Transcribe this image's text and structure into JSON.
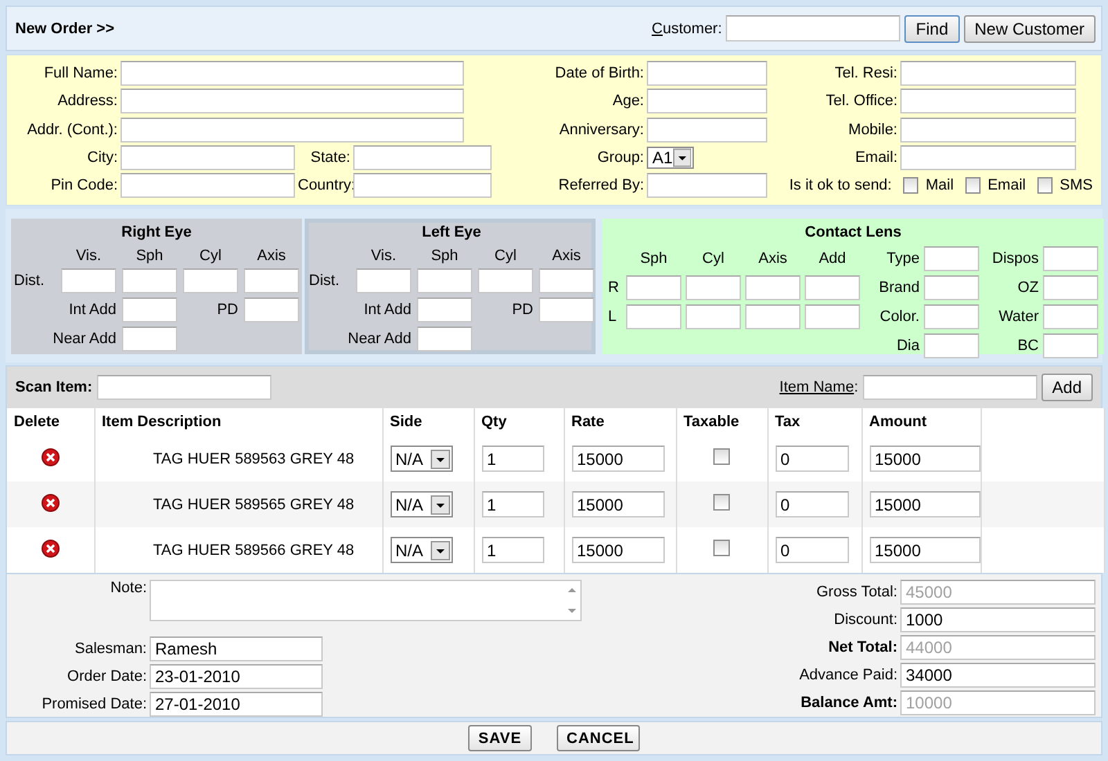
{
  "header": {
    "title": "New Order >>",
    "customer": {
      "label": "Customer",
      "suffix": ":"
    },
    "buttons": [
      "Find",
      "New Customer"
    ]
  },
  "customer": {
    "col1": [
      {
        "fields": [
          {
            "label": "Full Name:"
          }
        ]
      },
      {
        "fields": [
          {
            "label": "Address:"
          }
        ]
      },
      {
        "fields": [
          {
            "label": "Addr. (Cont.):"
          }
        ]
      },
      {
        "fields": [
          {
            "label": "City:"
          },
          {
            "label": "State:"
          }
        ]
      },
      {
        "fields": [
          {
            "label": "Pin Code:"
          },
          {
            "label": "Country:"
          }
        ]
      }
    ],
    "col2": [
      {
        "label": "Date of Birth:",
        "kind": "text"
      },
      {
        "label": "Age:",
        "kind": "text"
      },
      {
        "label": "Anniversary:",
        "kind": "text"
      },
      {
        "label": "Group:",
        "kind": "select",
        "value": "A1"
      },
      {
        "label": "Referred By:",
        "kind": "text"
      }
    ],
    "col3": [
      {
        "label": "Tel. Resi:"
      },
      {
        "label": "Tel. Office:"
      },
      {
        "label": "Mobile:"
      },
      {
        "label": "Email:"
      }
    ],
    "send": {
      "label": "Is it ok to send:",
      "options": [
        {
          "label": "Mail",
          "checked": false
        },
        {
          "label": "Email",
          "checked": false
        },
        {
          "label": "SMS",
          "checked": false
        }
      ]
    }
  },
  "eyes": [
    {
      "title": "Right Eye",
      "selected": false,
      "columns": [
        "Vis.",
        "Sph",
        "Cyl",
        "Axis"
      ],
      "dist": "Dist.",
      "int_add": "Int Add",
      "pd": "PD",
      "near_add": "Near Add"
    },
    {
      "title": "Left Eye",
      "selected": true,
      "columns": [
        "Vis.",
        "Sph",
        "Cyl",
        "Axis"
      ],
      "dist": "Dist.",
      "int_add": "Int Add",
      "pd": "PD",
      "near_add": "Near Add"
    }
  ],
  "contact_lens": {
    "title": "Contact Lens",
    "columns": [
      "Sph",
      "Cyl",
      "Axis",
      "Add"
    ],
    "rows": [
      "R",
      "L"
    ],
    "side_fields": [
      [
        "Type",
        "Dispos"
      ],
      [
        "Brand",
        "OZ"
      ],
      [
        "Color.",
        "Water"
      ],
      [
        "Dia",
        "BC"
      ]
    ]
  },
  "scan_bar": {
    "scan_label": "Scan Item:",
    "item_name": {
      "label": "Item Name",
      "suffix": ":"
    },
    "button": "Add"
  },
  "table": {
    "columns": [
      "Delete",
      "Item Description",
      "Side",
      "Qty",
      "Rate",
      "Taxable",
      "Tax",
      "Amount"
    ],
    "rows": [
      {
        "description": "TAG HUER 589563 GREY 48",
        "side": "N/A",
        "qty": "1",
        "rate": "15000",
        "taxable": false,
        "tax": "0",
        "amount": "15000"
      },
      {
        "description": "TAG HUER 589565 GREY 48",
        "side": "N/A",
        "qty": "1",
        "rate": "15000",
        "taxable": false,
        "tax": "0",
        "amount": "15000"
      },
      {
        "description": "TAG HUER 589566 GREY 48",
        "side": "N/A",
        "qty": "1",
        "rate": "15000",
        "taxable": false,
        "tax": "0",
        "amount": "15000"
      }
    ]
  },
  "footer": {
    "note_label": "Note:",
    "left": [
      {
        "label": "Salesman:",
        "value": "Ramesh"
      },
      {
        "label": "Order Date:",
        "value": "23-01-2010"
      },
      {
        "label": "Promised Date:",
        "value": "27-01-2010"
      }
    ],
    "totals": [
      {
        "label": "Gross Total:",
        "value": "45000",
        "readonly": true,
        "bold": false
      },
      {
        "label": "Discount:",
        "value": "1000",
        "readonly": false,
        "bold": false
      },
      {
        "label": "Net Total:",
        "value": "44000",
        "readonly": true,
        "bold": true
      },
      {
        "label": "Advance Paid:",
        "value": "34000",
        "readonly": false,
        "bold": false
      },
      {
        "label": "Balance Amt:",
        "value": "10000",
        "readonly": true,
        "bold": true
      }
    ]
  },
  "actions": [
    "SAVE",
    "CANCEL"
  ]
}
